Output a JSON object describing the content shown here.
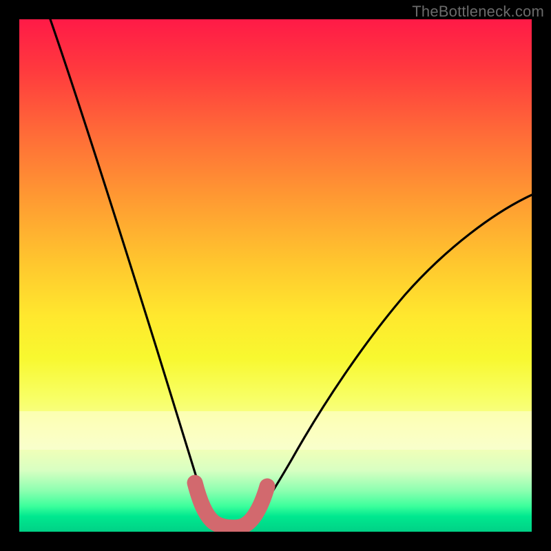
{
  "watermark": "TheBottleneck.com",
  "chart_data": {
    "type": "line",
    "title": "",
    "xlabel": "",
    "ylabel": "",
    "xlim": [
      0,
      100
    ],
    "ylim": [
      0,
      100
    ],
    "series": [
      {
        "name": "bottleneck-curve",
        "x": [
          6,
          10,
          15,
          20,
          25,
          28,
          30,
          32,
          34,
          36,
          38,
          40,
          42,
          44,
          48,
          55,
          62,
          70,
          80,
          90,
          100
        ],
        "y": [
          100,
          86,
          70,
          54,
          38,
          27,
          20,
          13,
          8,
          4,
          2,
          1.5,
          2,
          4,
          10,
          22,
          33,
          43,
          53,
          60,
          65
        ]
      }
    ],
    "highlight_region": {
      "name": "optimal-range-marker",
      "color": "#d2696e",
      "x": [
        32,
        34,
        36,
        38,
        40,
        42,
        44
      ],
      "y": [
        9,
        4.5,
        2.5,
        2,
        2,
        2.5,
        5
      ]
    },
    "legend": false,
    "grid": false
  }
}
